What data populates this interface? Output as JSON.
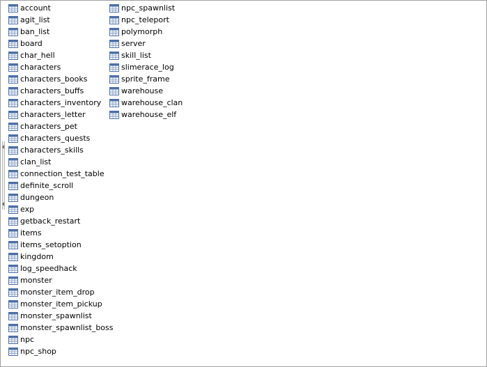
{
  "table_list": {
    "icon": "table-icon",
    "columns": [
      [
        "account",
        "agit_list",
        "ban_list",
        "board",
        "char_hell",
        "characters",
        "characters_books",
        "characters_buffs",
        "characters_inventory",
        "characters_letter",
        "characters_pet",
        "characters_quests",
        "characters_skills",
        "clan_list",
        "connection_test_table",
        "definite_scroll",
        "dungeon",
        "exp",
        "getback_restart",
        "items",
        "items_setoption",
        "kingdom",
        "log_speedhack",
        "monster",
        "monster_item_drop",
        "monster_item_pickup",
        "monster_spawnlist",
        "monster_spawnlist_boss",
        "npc",
        "npc_shop"
      ],
      [
        "npc_spawnlist",
        "npc_teleport",
        "polymorph",
        "server",
        "skill_list",
        "slimerace_log",
        "sprite_frame",
        "warehouse",
        "warehouse_clan",
        "warehouse_elf"
      ]
    ]
  },
  "colors": {
    "icon_header": "#4d6fa8",
    "icon_grid": "#8fa6c9",
    "icon_cell": "#ffffff",
    "border": "#a0a0a0"
  }
}
